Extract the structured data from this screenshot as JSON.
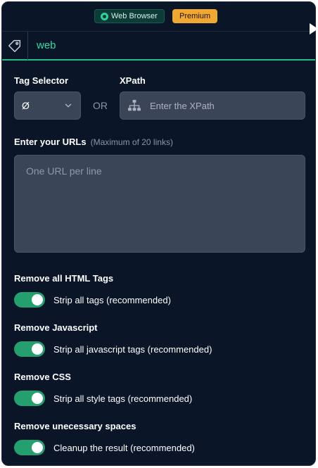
{
  "topbar": {
    "web_badge": "Web Browser",
    "premium_badge": "Premium"
  },
  "header": {
    "title": "web",
    "icon": "tag-icon"
  },
  "selector": {
    "tag_label": "Tag Selector",
    "tag_value": "Ø",
    "or_text": "OR",
    "xpath_label": "XPath",
    "xpath_placeholder": "Enter the XPath",
    "xpath_icon": "sitemap-icon"
  },
  "urls": {
    "label": "Enter your URLs",
    "hint": "(Maximum of 20 links)",
    "placeholder": "One URL per line"
  },
  "options": [
    {
      "label": "Remove all HTML Tags",
      "toggle_text": "Strip all tags (recommended)",
      "enabled": true
    },
    {
      "label": "Remove Javascript",
      "toggle_text": "Strip all javascript tags (recommended)",
      "enabled": true
    },
    {
      "label": "Remove CSS",
      "toggle_text": "Strip all style tags (recommended)",
      "enabled": true
    },
    {
      "label": "Remove unecessary spaces",
      "toggle_text": "Cleanup the result (recommended)",
      "enabled": true
    }
  ],
  "colors": {
    "background": "#0b1528",
    "accent": "#2fdfa0",
    "toggle_on": "#24a06e",
    "premium": "#f0a830"
  }
}
